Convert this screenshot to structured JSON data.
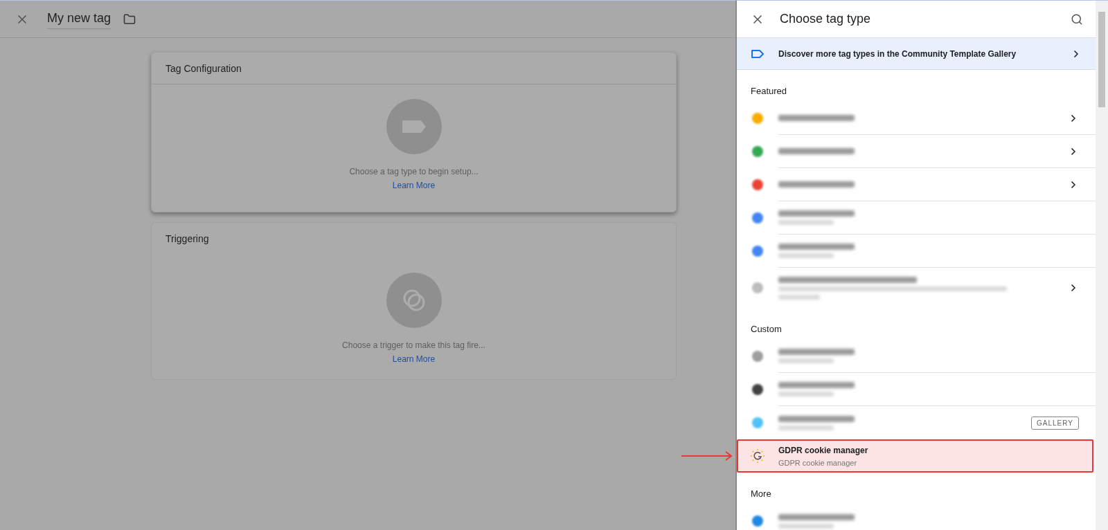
{
  "top_bar": {
    "tag_name": "My new tag"
  },
  "cards": [
    {
      "kind": "tag",
      "title": "Tag Configuration",
      "message": "Choose a tag type to begin setup...",
      "link": "Learn More",
      "raised": true
    },
    {
      "kind": "trigger",
      "title": "Triggering",
      "message": "Choose a trigger to make this tag fire...",
      "link": "Learn More",
      "raised": false
    }
  ],
  "panel": {
    "title": "Choose tag type",
    "banner": "Discover more tag types in the Community Template Gallery",
    "sections": [
      {
        "heading": "Featured",
        "items": [
          {
            "kind": "blurred",
            "color": "#f9ab00",
            "subtitle": false,
            "chevron": true
          },
          {
            "kind": "blurred",
            "color": "#34a853",
            "subtitle": false,
            "chevron": true
          },
          {
            "kind": "blurred",
            "color": "#ea4335",
            "subtitle": false,
            "chevron": true
          },
          {
            "kind": "blurred",
            "color": "#4285f4",
            "subtitle": true,
            "chevron": false
          },
          {
            "kind": "blurred",
            "color": "#4285f4",
            "subtitle": true,
            "chevron": false
          },
          {
            "kind": "blurred",
            "color": "#bdbdbd",
            "subtitle": true,
            "tall": true,
            "chevron": true
          }
        ]
      },
      {
        "heading": "Custom",
        "items": [
          {
            "kind": "blurred",
            "color": "#9e9e9e",
            "subtitle": true,
            "chevron": false
          },
          {
            "kind": "blurred",
            "color": "#424242",
            "subtitle": true,
            "chevron": false
          },
          {
            "kind": "blurred",
            "color": "#4fc3f7",
            "subtitle": true,
            "chevron": false,
            "badge": "GALLERY"
          },
          {
            "kind": "item",
            "title": "GDPR cookie manager",
            "subtitle_text": "GDPR cookie manager",
            "highlighted": true,
            "pointer_arrow": true
          }
        ]
      },
      {
        "heading": "More",
        "items": [
          {
            "kind": "blurred",
            "color": "#1e88e5",
            "subtitle": true,
            "chevron": false
          }
        ]
      }
    ]
  }
}
